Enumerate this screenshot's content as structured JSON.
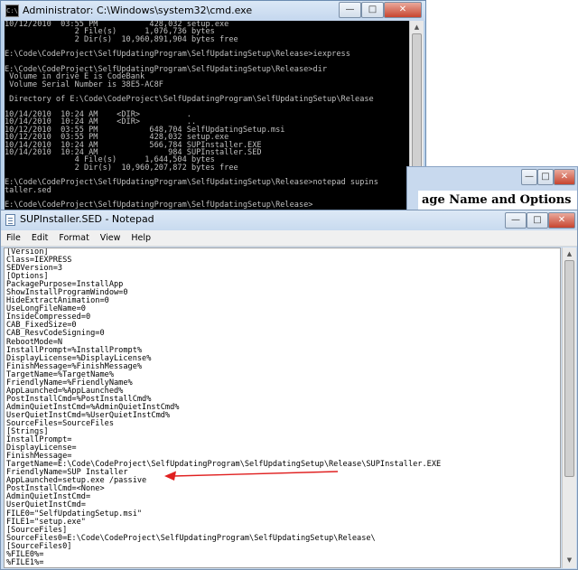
{
  "cmd": {
    "title": "Administrator: C:\\Windows\\system32\\cmd.exe",
    "icon_text": "C:\\",
    "buttons": {
      "minimize": "—",
      "maximize": "□",
      "close": "✕"
    },
    "lines": [
      "10/12/2010  03:55 PM           428,032 setup.exe",
      "               2 File(s)      1,076,736 bytes",
      "               2 Dir(s)  10,960,891,904 bytes free",
      "",
      "E:\\Code\\CodeProject\\SelfUpdatingProgram\\SelfUpdatingSetup\\Release>iexpress",
      "",
      "E:\\Code\\CodeProject\\SelfUpdatingProgram\\SelfUpdatingSetup\\Release>dir",
      " Volume in drive E is CodeBank",
      " Volume Serial Number is 38E5-AC8F",
      "",
      " Directory of E:\\Code\\CodeProject\\SelfUpdatingProgram\\SelfUpdatingSetup\\Release",
      "",
      "10/14/2010  10:24 AM    <DIR>          .",
      "10/14/2010  10:24 AM    <DIR>          ..",
      "10/12/2010  03:55 PM           648,704 SelfUpdatingSetup.msi",
      "10/12/2010  03:55 PM           428,032 setup.exe",
      "10/14/2010  10:24 AM           566,784 SUPInstaller.EXE",
      "10/14/2010  10:24 AM               984 SUPInstaller.SED",
      "               4 File(s)      1,644,504 bytes",
      "               2 Dir(s)  10,960,207,872 bytes free",
      "",
      "E:\\Code\\CodeProject\\SelfUpdatingProgram\\SelfUpdatingSetup\\Release>notepad supins",
      "taller.sed",
      "",
      "E:\\Code\\CodeProject\\SelfUpdatingProgram\\SelfUpdatingSetup\\Release>"
    ]
  },
  "background_window": {
    "heading": "age Name and Options",
    "buttons": {
      "minimize": "—",
      "maximize": "□",
      "close": "✕"
    }
  },
  "notepad": {
    "title": "SUPInstaller.SED - Notepad",
    "buttons": {
      "minimize": "—",
      "maximize": "□",
      "close": "✕"
    },
    "menu": [
      "File",
      "Edit",
      "Format",
      "View",
      "Help"
    ],
    "lines": [
      "[Version]",
      "Class=IEXPRESS",
      "SEDVersion=3",
      "[Options]",
      "PackagePurpose=InstallApp",
      "ShowInstallProgramWindow=0",
      "HideExtractAnimation=0",
      "UseLongFileName=0",
      "InsideCompressed=0",
      "CAB_FixedSize=0",
      "CAB_ResvCodeSigning=0",
      "RebootMode=N",
      "InstallPrompt=%InstallPrompt%",
      "DisplayLicense=%DisplayLicense%",
      "FinishMessage=%FinishMessage%",
      "TargetName=%TargetName%",
      "FriendlyName=%FriendlyName%",
      "AppLaunched=%AppLaunched%",
      "PostInstallCmd=%PostInstallCmd%",
      "AdminQuietInstCmd=%AdminQuietInstCmd%",
      "UserQuietInstCmd=%UserQuietInstCmd%",
      "SourceFiles=SourceFiles",
      "[Strings]",
      "InstallPrompt=",
      "DisplayLicense=",
      "FinishMessage=",
      "TargetName=E:\\Code\\CodeProject\\SelfUpdatingProgram\\SelfUpdatingSetup\\Release\\SUPInstaller.EXE",
      "FriendlyName=SUP Installer",
      "AppLaunched=setup.exe /passive",
      "PostInstallCmd=<None>",
      "AdminQuietInstCmd=",
      "UserQuietInstCmd=",
      "FILE0=\"SelfUpdatingSetup.msi\"",
      "FILE1=\"setup.exe\"",
      "[SourceFiles]",
      "SourceFiles0=E:\\Code\\CodeProject\\SelfUpdatingProgram\\SelfUpdatingSetup\\Release\\",
      "[SourceFiles0]",
      "%FILE0%=",
      "%FILE1%="
    ]
  },
  "annotation": {
    "arrow_color": "#e02020"
  }
}
